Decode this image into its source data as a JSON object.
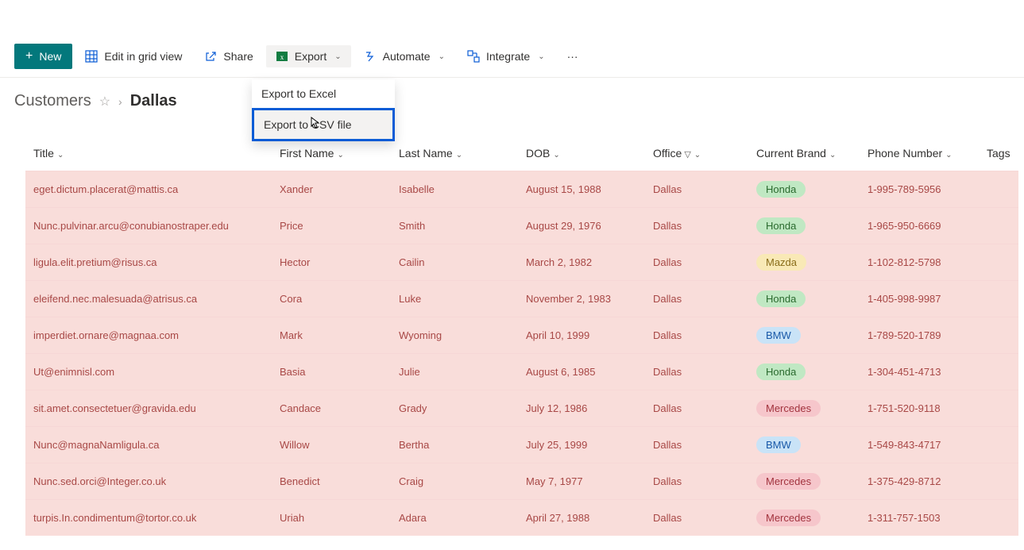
{
  "toolbar": {
    "new_label": "New",
    "edit_grid_label": "Edit in grid view",
    "share_label": "Share",
    "export_label": "Export",
    "automate_label": "Automate",
    "integrate_label": "Integrate",
    "more_label": "···"
  },
  "export_menu": {
    "excel": "Export to Excel",
    "csv": "Export to CSV file"
  },
  "breadcrumb": {
    "list_name": "Customers",
    "view_name": "Dallas"
  },
  "columns": {
    "title": "Title",
    "first_name": "First Name",
    "last_name": "Last Name",
    "dob": "DOB",
    "office": "Office",
    "brand": "Current Brand",
    "phone": "Phone Number",
    "tags": "Tags"
  },
  "brand_styles": {
    "Honda": "pill-honda",
    "Mazda": "pill-mazda",
    "BMW": "pill-bmw",
    "Mercedes": "pill-mercedes"
  },
  "rows": [
    {
      "title": "eget.dictum.placerat@mattis.ca",
      "first": "Xander",
      "last": "Isabelle",
      "dob": "August 15, 1988",
      "office": "Dallas",
      "brand": "Honda",
      "phone": "1-995-789-5956"
    },
    {
      "title": "Nunc.pulvinar.arcu@conubianostraper.edu",
      "first": "Price",
      "last": "Smith",
      "dob": "August 29, 1976",
      "office": "Dallas",
      "brand": "Honda",
      "phone": "1-965-950-6669"
    },
    {
      "title": "ligula.elit.pretium@risus.ca",
      "first": "Hector",
      "last": "Cailin",
      "dob": "March 2, 1982",
      "office": "Dallas",
      "brand": "Mazda",
      "phone": "1-102-812-5798"
    },
    {
      "title": "eleifend.nec.malesuada@atrisus.ca",
      "first": "Cora",
      "last": "Luke",
      "dob": "November 2, 1983",
      "office": "Dallas",
      "brand": "Honda",
      "phone": "1-405-998-9987"
    },
    {
      "title": "imperdiet.ornare@magnaa.com",
      "first": "Mark",
      "last": "Wyoming",
      "dob": "April 10, 1999",
      "office": "Dallas",
      "brand": "BMW",
      "phone": "1-789-520-1789"
    },
    {
      "title": "Ut@enimnisl.com",
      "first": "Basia",
      "last": "Julie",
      "dob": "August 6, 1985",
      "office": "Dallas",
      "brand": "Honda",
      "phone": "1-304-451-4713"
    },
    {
      "title": "sit.amet.consectetuer@gravida.edu",
      "first": "Candace",
      "last": "Grady",
      "dob": "July 12, 1986",
      "office": "Dallas",
      "brand": "Mercedes",
      "phone": "1-751-520-9118"
    },
    {
      "title": "Nunc@magnaNamligula.ca",
      "first": "Willow",
      "last": "Bertha",
      "dob": "July 25, 1999",
      "office": "Dallas",
      "brand": "BMW",
      "phone": "1-549-843-4717"
    },
    {
      "title": "Nunc.sed.orci@Integer.co.uk",
      "first": "Benedict",
      "last": "Craig",
      "dob": "May 7, 1977",
      "office": "Dallas",
      "brand": "Mercedes",
      "phone": "1-375-429-8712"
    },
    {
      "title": "turpis.In.condimentum@tortor.co.uk",
      "first": "Uriah",
      "last": "Adara",
      "dob": "April 27, 1988",
      "office": "Dallas",
      "brand": "Mercedes",
      "phone": "1-311-757-1503"
    }
  ]
}
